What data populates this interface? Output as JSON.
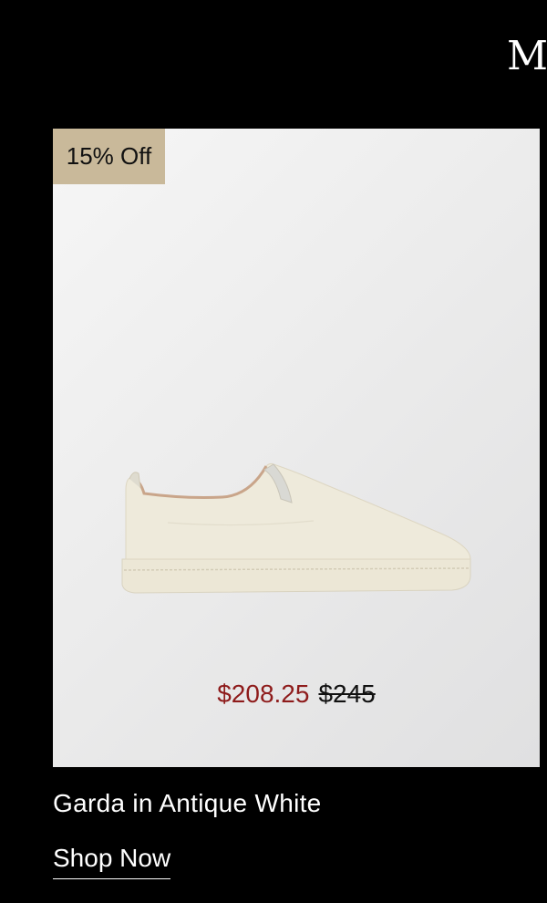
{
  "header": {
    "brand_letter": "M"
  },
  "product": {
    "badge": "15% Off",
    "image_alt": "Garda slip-on sneaker in antique white",
    "sale_price": "$208.25",
    "original_price": "$245",
    "name": "Garda in Antique White",
    "cta_label": "Shop Now"
  },
  "colors": {
    "page_background": "#000000",
    "badge_background": "#c9b99a",
    "sale_price": "#8e1b1b",
    "card_background": "#ececec"
  }
}
